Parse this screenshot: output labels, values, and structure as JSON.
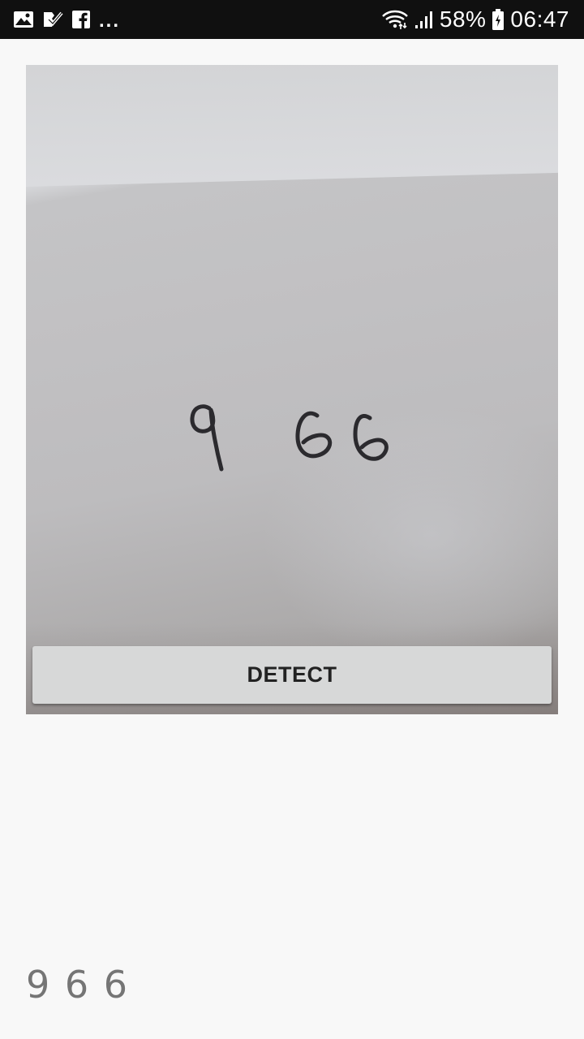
{
  "status_bar": {
    "battery_percent": "58%",
    "time": "06:47",
    "overflow": "...",
    "icons": [
      "gallery-icon",
      "task-check-icon",
      "facebook-icon",
      "wifi-icon",
      "signal-icon",
      "battery-icon"
    ]
  },
  "preview": {
    "handwritten_digits": [
      "9",
      "6",
      "6"
    ]
  },
  "detect_button": {
    "label": "DETECT"
  },
  "result": {
    "text": "9 6 6"
  },
  "colors": {
    "background": "#f8f8f8",
    "status_bar": "#101010",
    "button": "#d7d8d8",
    "button_text": "#222222",
    "result_text": "#757575"
  }
}
